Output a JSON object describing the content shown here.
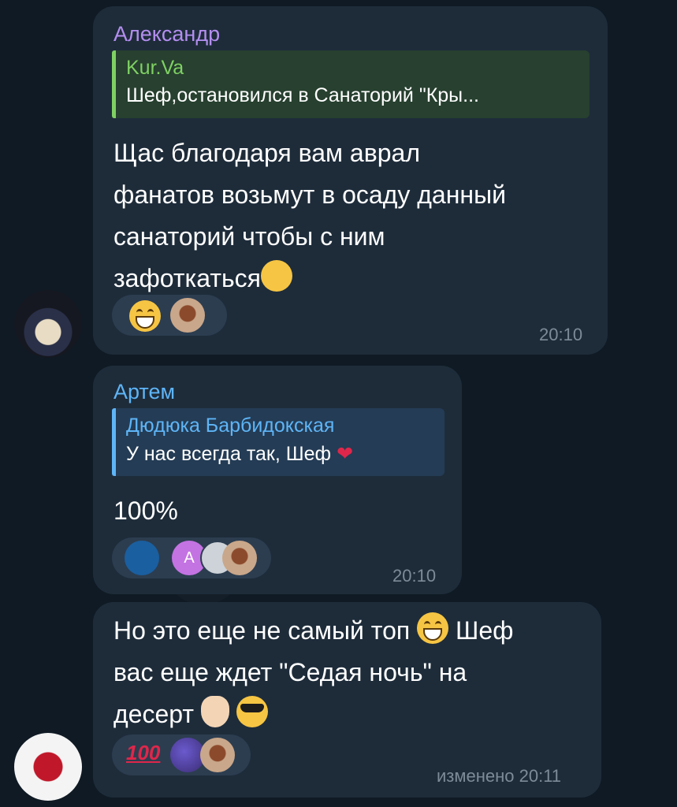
{
  "messages": [
    {
      "sender": "Александр",
      "sender_color": "#b48ef0",
      "reply_name": "Kur.Va",
      "reply_text": "Шеф,остановился в Санаторий \"Кры...",
      "reply_color": "#7fd163",
      "text_lines": [
        "Щас благодаря вам аврал",
        "фанатов возьмут в осаду данный",
        "санаторий чтобы с ним",
        "зафоткаться"
      ],
      "reactions": [
        "grinning-emoji",
        "user-avatar-photo"
      ],
      "time": "20:10"
    },
    {
      "sender": "Артем",
      "sender_color": "#5eb5f7",
      "reply_name": "Дюдюка Барбидокская",
      "reply_text": "У нас всегда так, Шеф",
      "reply_color": "#5eb5f7",
      "text": "100%",
      "reactions": [
        "team-logo-avatar",
        "avatar-letter-a",
        "avatar-photo",
        "avatar-photo"
      ],
      "avatar_letter": "А",
      "time": "20:10"
    },
    {
      "text_lines": [
        "Но это еще не самый топ",
        "вас еще ждет \"Седая ночь\" на",
        "десерт"
      ],
      "inline_word": "Шеф",
      "reactions": [
        "hundred-points-emoji",
        "avatar-photo",
        "avatar-photo"
      ],
      "hundred": "100",
      "time": "изменено 20:11"
    }
  ],
  "colors": {
    "bubble": "#1e2c3a",
    "background": "#0f1a24",
    "accent": "#5eb5f7"
  }
}
